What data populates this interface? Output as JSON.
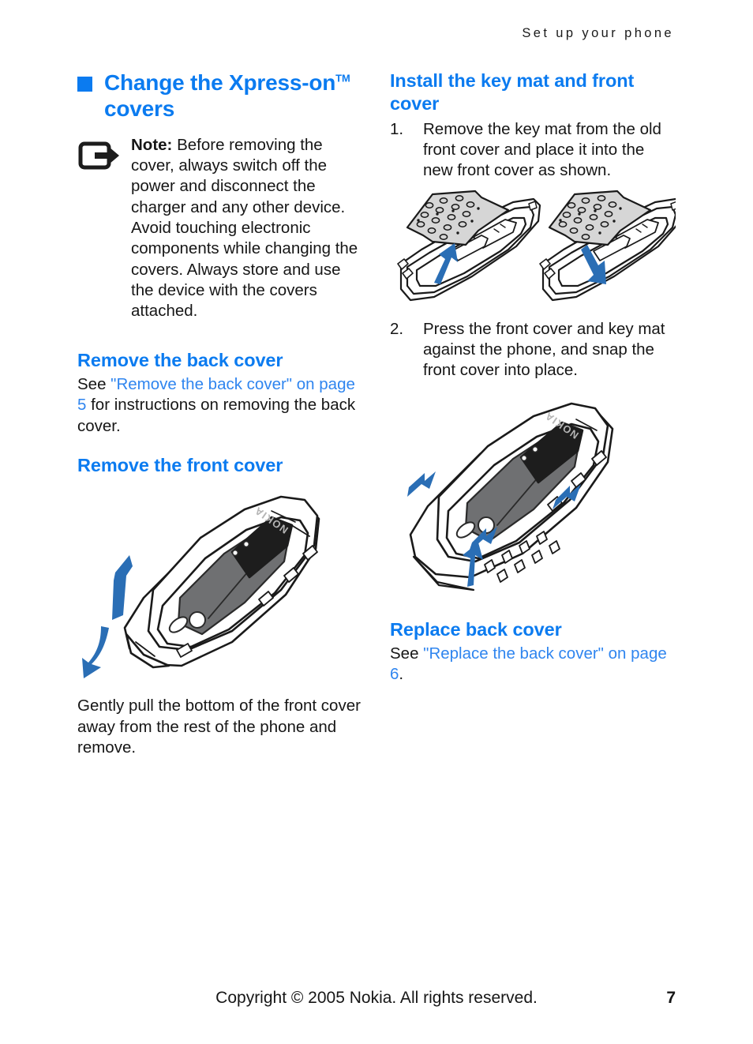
{
  "header": {
    "running_head": "Set up your phone"
  },
  "left_column": {
    "main_heading": {
      "text": "Change the Xpress-on",
      "superscript": "TM",
      "text_line2": "covers",
      "bullet_color": "#0b7bf0"
    },
    "note": {
      "icon": "note-arrow-icon",
      "label": "Note:",
      "text": " Before removing the cover, always switch off the power and disconnect the charger and any other device. Avoid touching electronic components while changing the covers. Always store and use the device with the covers attached."
    },
    "section_remove_back": {
      "heading": "Remove the back cover",
      "para_pre": "See ",
      "para_link": "\"Remove the back cover\" on page 5",
      "para_post": " for instructions on removing the back cover."
    },
    "section_remove_front": {
      "heading": "Remove the front cover",
      "figure_alt": "phone-front-cover-removal-illustration",
      "caption": "Gently pull the bottom of the front cover away from the rest of the phone and remove."
    }
  },
  "right_column": {
    "section_install": {
      "heading_line1": "Install the key mat and front",
      "heading_line2": "cover",
      "steps": [
        {
          "num": "1.",
          "text": "Remove the key mat from the old front cover and place it into the new front cover as shown."
        },
        {
          "num": "2.",
          "text": "Press the front cover and key mat against the phone, and snap the front cover into place."
        }
      ],
      "figure_keymat_alt": "key-mat-install-illustration",
      "figure_cover_alt": "front-cover-snap-illustration"
    },
    "section_replace_back": {
      "heading": "Replace back cover",
      "para_pre": "See ",
      "para_link": "\"Replace the back cover\" on page 6",
      "para_post": "."
    }
  },
  "footer": {
    "copyright": "Copyright © 2005 Nokia. All rights reserved.",
    "page_number": "7"
  },
  "colors": {
    "heading_blue": "#0b7bf0",
    "link_blue": "#2f85ef",
    "arrow_blue": "#2a6eb5",
    "keymat_gray": "#d6d6d6",
    "battery_gray": "#6f7072"
  }
}
